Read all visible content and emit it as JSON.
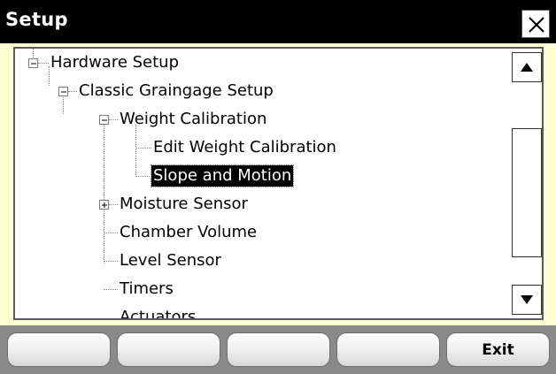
{
  "window": {
    "title": "Setup",
    "close_glyph": "close-icon"
  },
  "tree": {
    "items": [
      {
        "label": "Hardware Setup",
        "level": 0,
        "expander": "minus"
      },
      {
        "label": "Classic Graingage Setup",
        "level": 1,
        "expander": "minus"
      },
      {
        "label": "Weight Calibration",
        "level": 2,
        "expander": "minus"
      },
      {
        "label": "Edit Weight Calibration",
        "level": 3,
        "expander": "none"
      },
      {
        "label": "Slope and Motion",
        "level": 3,
        "expander": "none",
        "selected": true
      },
      {
        "label": "Moisture Sensor",
        "level": 2,
        "expander": "plus"
      },
      {
        "label": "Chamber Volume",
        "level": 2,
        "expander": "none"
      },
      {
        "label": "Level Sensor",
        "level": 2,
        "expander": "none"
      },
      {
        "label": "Timers",
        "level": 2,
        "expander": "none"
      },
      {
        "label": "Actuators",
        "level": 2,
        "expander": "none"
      }
    ]
  },
  "scrollbar": {
    "up_icon": "arrow-up-icon",
    "down_icon": "arrow-down-icon"
  },
  "footer": {
    "buttons": [
      "",
      "",
      "",
      "",
      "Exit"
    ]
  },
  "colors": {
    "titlebar": "#000000",
    "window_bg": "#ffffd4",
    "footer_bg": "#8a8a8a",
    "selection": "#000000"
  }
}
